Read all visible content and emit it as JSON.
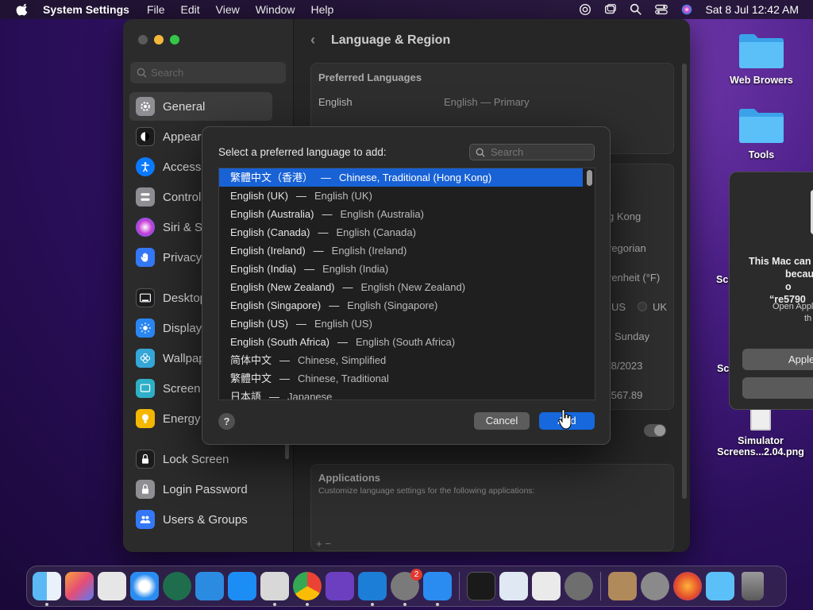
{
  "menubar": {
    "app_name": "System Settings",
    "menus": [
      "File",
      "Edit",
      "View",
      "Window",
      "Help"
    ],
    "clock": "Sat 8 Jul  12:42 AM"
  },
  "sidebar": {
    "search_placeholder": "Search",
    "items": [
      {
        "label": "General",
        "icon": "gear-icon",
        "color": "#8e8e93"
      },
      {
        "label": "Appearance",
        "icon": "appearance-icon",
        "color": "#1c1c1e"
      },
      {
        "label": "Accessibility",
        "icon": "accessibility-icon",
        "color": "#0a7aff"
      },
      {
        "label": "Control Centre",
        "icon": "control-centre-icon",
        "color": "#8e8e93"
      },
      {
        "label": "Siri & Spotlight",
        "icon": "siri-icon",
        "color": "#c83cd6"
      },
      {
        "label": "Privacy & Security",
        "icon": "hand-icon",
        "color": "#3478f6"
      },
      {
        "label": "Desktop & Dock",
        "icon": "desktop-icon",
        "color": "#1c1c1e"
      },
      {
        "label": "Displays",
        "icon": "sun-icon",
        "color": "#2a86f2"
      },
      {
        "label": "Wallpaper",
        "icon": "flower-icon",
        "color": "#35a7d8"
      },
      {
        "label": "Screen Saver",
        "icon": "screensaver-icon",
        "color": "#2fb0c8"
      },
      {
        "label": "Energy Saver",
        "icon": "bulb-icon",
        "color": "#f5b800"
      },
      {
        "label": "Lock Screen",
        "icon": "lock-icon",
        "color": "#1c1c1e"
      },
      {
        "label": "Login Password",
        "icon": "padlock-icon",
        "color": "#8e8e93"
      },
      {
        "label": "Users & Groups",
        "icon": "users-icon",
        "color": "#3478f6"
      }
    ]
  },
  "main": {
    "title": "Language & Region",
    "preferred_languages_heading": "Preferred Languages",
    "primary_language": "English",
    "primary_language_note": "English — Primary",
    "region_value": "g Kong",
    "calendar_value": "regorian",
    "temperature_value": "renheit (°F)",
    "measurement_us": "US",
    "measurement_uk": "UK",
    "first_day": "Sunday",
    "date_format": "/8/2023",
    "number_format": ",567.89",
    "applications_heading": "Applications",
    "applications_desc": "Customize language settings for the following applications:",
    "add_remove": "+  −"
  },
  "dialog": {
    "title": "Select a preferred language to add:",
    "search_placeholder": "Search",
    "languages": [
      {
        "name": "繁體中文（香港）",
        "desc": "Chinese, Traditional (Hong Kong)",
        "selected": true
      },
      {
        "name": "English (UK)",
        "desc": "English (UK)"
      },
      {
        "name": "English (Australia)",
        "desc": "English (Australia)"
      },
      {
        "name": "English (Canada)",
        "desc": "English (Canada)"
      },
      {
        "name": "English (Ireland)",
        "desc": "English (Ireland)"
      },
      {
        "name": "English (India)",
        "desc": "English (India)"
      },
      {
        "name": "English (New Zealand)",
        "desc": "English (New Zealand)"
      },
      {
        "name": "English (Singapore)",
        "desc": "English (Singapore)"
      },
      {
        "name": "English (US)",
        "desc": "English (US)"
      },
      {
        "name": "English (South Africa)",
        "desc": "English (South Africa)"
      },
      {
        "name": "简体中文",
        "desc": "Chinese, Simplified"
      },
      {
        "name": "繁體中文",
        "desc": "Chinese, Traditional"
      },
      {
        "name": "日本語",
        "desc": "Japanese"
      }
    ],
    "separator": "—",
    "help_label": "?",
    "cancel_label": "Cancel",
    "add_label": "Add"
  },
  "desktop": {
    "folder1": "Web Browers",
    "folder2": "Tools",
    "sc1": "Scr",
    "sc2": "Sc",
    "simulator_line1": "Simulator",
    "simulator_line2": "Screens...2.04.png"
  },
  "alert": {
    "text_line1": "This Mac can",
    "text_line2": "because o",
    "text_line3": "“re5790",
    "sub_line1": "Open Appl",
    "sub_line2": "th",
    "button_label": "Apple"
  },
  "dock": {
    "apps": [
      "finder-icon",
      "launchpad-icon",
      "textedit-icon",
      "safari-icon",
      "time-machine-icon",
      "testflight-icon",
      "app-store-icon",
      "xcode-icon",
      "chrome-icon",
      "visual-studio-icon",
      "vscode-icon",
      "system-settings-icon",
      "simulator-icon"
    ],
    "settings_badge": "2",
    "others": [
      "activity-monitor-icon",
      "preview-icon",
      "screenshot-icon",
      "system-settings-gear-icon",
      "archive-utility-icon",
      "disk-utility-icon",
      "firefox-icon",
      "folder-icon",
      "trash-icon"
    ]
  },
  "colors": {
    "accent": "#1668dc",
    "selection": "#1862d6"
  }
}
